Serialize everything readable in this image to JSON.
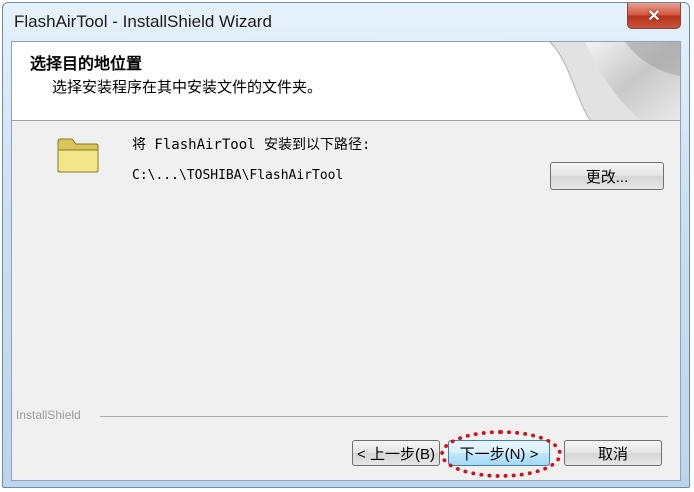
{
  "window": {
    "title": "FlashAirTool - InstallShield Wizard",
    "close_glyph": "✕"
  },
  "header": {
    "title": "选择目的地位置",
    "subtitle": "选择安装程序在其中安装文件的文件夹。"
  },
  "body": {
    "install_label": "将 FlashAirTool 安装到以下路径:",
    "install_path": "C:\\...\\TOSHIBA\\FlashAirTool",
    "change_button": "更改..."
  },
  "footer": {
    "brand": "InstallShield",
    "back_button": "< 上一步(B)",
    "next_button": "下一步(N) >",
    "cancel_button": "取消"
  },
  "icons": {
    "folder": "folder-icon",
    "close": "close-icon"
  },
  "colors": {
    "highlight": "#d0121b",
    "folder": "#f2e58a",
    "title_bar": "#c9dff2"
  }
}
